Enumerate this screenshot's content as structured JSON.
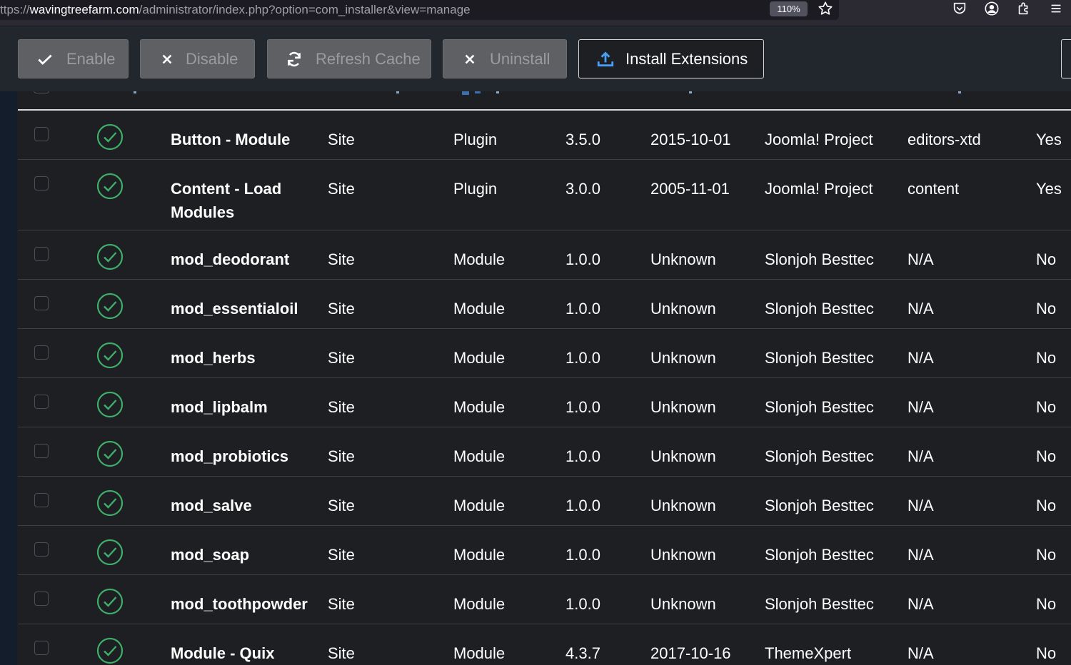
{
  "browser": {
    "url_prefix": "ttps://",
    "url_host": "wavingtreefarm.com",
    "url_path": "/administrator/index.php?option=com_installer&view=manage",
    "zoom": "110%"
  },
  "toolbar": {
    "enable_label": "Enable",
    "disable_label": "Disable",
    "refresh_label": "Refresh Cache",
    "uninstall_label": "Uninstall",
    "install_label": "Install Extensions"
  },
  "colors": {
    "background": "#1e1f23",
    "status_green": "#3fae6a",
    "disabled_button": "#5f6063"
  },
  "rows": [
    {
      "name": "Button - Module",
      "location": "Site",
      "type": "Plugin",
      "version": "3.5.0",
      "date": "2015-10-01",
      "author": "Joomla! Project",
      "folder": "editors-xtd",
      "core": "Yes"
    },
    {
      "name": "Content - Load Modules",
      "location": "Site",
      "type": "Plugin",
      "version": "3.0.0",
      "date": "2005-11-01",
      "author": "Joomla! Project",
      "folder": "content",
      "core": "Yes"
    },
    {
      "name": "mod_deodorant",
      "location": "Site",
      "type": "Module",
      "version": "1.0.0",
      "date": "Unknown",
      "author": "Slonjoh Besttec",
      "folder": "N/A",
      "core": "No"
    },
    {
      "name": "mod_essentialoil",
      "location": "Site",
      "type": "Module",
      "version": "1.0.0",
      "date": "Unknown",
      "author": "Slonjoh Besttec",
      "folder": "N/A",
      "core": "No"
    },
    {
      "name": "mod_herbs",
      "location": "Site",
      "type": "Module",
      "version": "1.0.0",
      "date": "Unknown",
      "author": "Slonjoh Besttec",
      "folder": "N/A",
      "core": "No"
    },
    {
      "name": "mod_lipbalm",
      "location": "Site",
      "type": "Module",
      "version": "1.0.0",
      "date": "Unknown",
      "author": "Slonjoh Besttec",
      "folder": "N/A",
      "core": "No"
    },
    {
      "name": "mod_probiotics",
      "location": "Site",
      "type": "Module",
      "version": "1.0.0",
      "date": "Unknown",
      "author": "Slonjoh Besttec",
      "folder": "N/A",
      "core": "No"
    },
    {
      "name": "mod_salve",
      "location": "Site",
      "type": "Module",
      "version": "1.0.0",
      "date": "Unknown",
      "author": "Slonjoh Besttec",
      "folder": "N/A",
      "core": "No"
    },
    {
      "name": "mod_soap",
      "location": "Site",
      "type": "Module",
      "version": "1.0.0",
      "date": "Unknown",
      "author": "Slonjoh Besttec",
      "folder": "N/A",
      "core": "No"
    },
    {
      "name": "mod_toothpowder",
      "location": "Site",
      "type": "Module",
      "version": "1.0.0",
      "date": "Unknown",
      "author": "Slonjoh Besttec",
      "folder": "N/A",
      "core": "No"
    },
    {
      "name": "Module - Quix",
      "location": "Site",
      "type": "Module",
      "version": "4.3.7",
      "date": "2017-10-16",
      "author": "ThemeXpert",
      "folder": "N/A",
      "core": "No"
    }
  ]
}
